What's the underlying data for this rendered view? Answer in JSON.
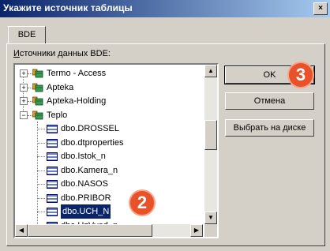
{
  "window": {
    "title": "Укажите источник таблицы",
    "close_glyph": "×"
  },
  "tab": {
    "label": "BDE"
  },
  "section_label": {
    "prefix": "И",
    "rest": "сточники данных BDE:"
  },
  "tree": {
    "databases": [
      {
        "name": "Termo - Access",
        "expanded": false
      },
      {
        "name": "Apteka",
        "expanded": false
      },
      {
        "name": "Apteka-Holding",
        "expanded": false
      },
      {
        "name": "Teplo",
        "expanded": true
      }
    ],
    "tables": [
      "dbo.DROSSEL",
      "dbo.dtproperties",
      "dbo.Istok_n",
      "dbo.Kamera_n",
      "dbo.NASOS",
      "dbo.PRIBOR",
      "dbo.UCH_N",
      "dbo.UzVvod_n"
    ],
    "selected": "dbo.UCH_N",
    "expand_glyph": "+",
    "collapse_glyph": "−"
  },
  "buttons": {
    "ok": "OK",
    "cancel": "Отмена",
    "choose_disk": "Выбрать на диске"
  },
  "annotations": {
    "badge_ok": "3",
    "badge_selected": "2"
  },
  "colors": {
    "badge": "#e8522b",
    "selection": "#0a246a",
    "title_bar": "#0a246a"
  },
  "icons": {
    "database": "database-icon",
    "table": "table-icon",
    "scroll_up": "▲",
    "scroll_down": "▼",
    "scroll_left": "◀",
    "scroll_right": "▶"
  }
}
